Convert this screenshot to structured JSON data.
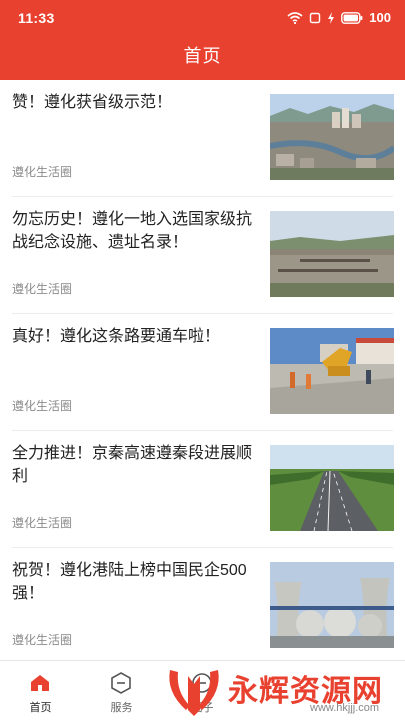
{
  "status_bar": {
    "time": "11:33",
    "battery": "100"
  },
  "header": {
    "title": "首页"
  },
  "feed": {
    "items": [
      {
        "title": "赞！遵化获省级示范！",
        "source": "遵化生活圈"
      },
      {
        "title": "勿忘历史！遵化一地入选国家级抗战纪念设施、遗址名录！",
        "source": "遵化生活圈"
      },
      {
        "title": "真好！遵化这条路要通车啦！",
        "source": "遵化生活圈"
      },
      {
        "title": "全力推进！京秦高速遵秦段进展顺利",
        "source": "遵化生活圈"
      },
      {
        "title": "祝贺！遵化港陆上榜中国民企500强！",
        "source": "遵化生活圈"
      }
    ]
  },
  "tabbar": {
    "tabs": [
      {
        "label": "首页",
        "icon": "home-icon",
        "active": true
      },
      {
        "label": "服务",
        "icon": "service-icon",
        "active": false
      },
      {
        "label": "圈子",
        "icon": "circle-icon",
        "active": false
      },
      {
        "label": "",
        "icon": "",
        "active": false
      },
      {
        "label": "",
        "icon": "",
        "active": false
      }
    ]
  },
  "watermark": {
    "text": "永辉资源网",
    "url": "www.hkjjj.com"
  },
  "colors": {
    "accent": "#e9412f",
    "source_text": "#8c8c8c",
    "divider": "#ececec"
  }
}
